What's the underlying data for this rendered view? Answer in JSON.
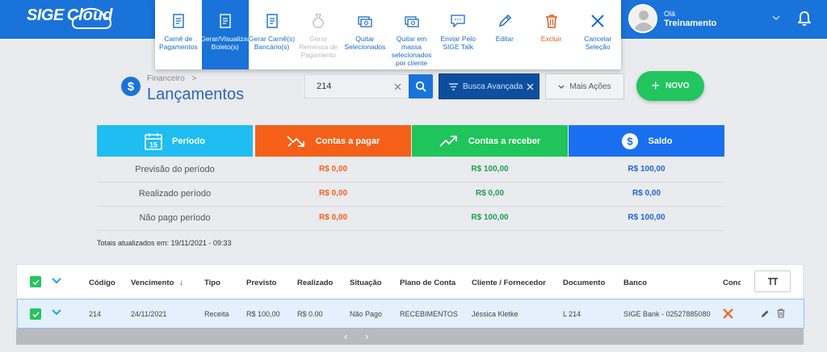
{
  "app": {
    "logo_part1": "SIGE",
    "logo_part2": "Cloud"
  },
  "user": {
    "greeting": "Olá",
    "name": "Treinamento"
  },
  "toolbar": {
    "items": [
      {
        "label": "Carnê de Pagamentos",
        "icon": "document-icon",
        "state": "normal"
      },
      {
        "label": "Gerar/Visualizar Boleto(s)",
        "icon": "document-icon",
        "state": "active"
      },
      {
        "label": "Gerar Carnê(s) Bancário(s)",
        "icon": "document-icon",
        "state": "normal"
      },
      {
        "label": "Gerar Remessa de Pagamento",
        "icon": "money-bag-icon",
        "state": "disabled"
      },
      {
        "label": "Quitar Selecionados",
        "icon": "cash-icon",
        "state": "normal"
      },
      {
        "label": "Quitar em massa selecionados por cliente",
        "icon": "cash-icon",
        "state": "normal"
      },
      {
        "label": "Enviar Pelo SIGE Talk",
        "icon": "chat-icon",
        "state": "normal"
      },
      {
        "label": "Editar",
        "icon": "pencil-icon",
        "state": "normal"
      },
      {
        "label": "Excluir",
        "icon": "trash-icon",
        "state": "danger"
      },
      {
        "label": "Cancelar Seleção",
        "icon": "close-icon",
        "state": "normal"
      }
    ]
  },
  "header": {
    "breadcrumb": "Financeiro",
    "breadcrumb_sep": ">",
    "title": "Lançamentos",
    "search_value": "214",
    "advanced_search": "Busca Avançada",
    "more_actions": "Mais Ações",
    "new_button": "NOVO"
  },
  "summary": {
    "cards": [
      {
        "label": "Período",
        "color": "#1fbdf2",
        "icon": "calendar-icon"
      },
      {
        "label": "Contas a pagar",
        "color": "#f4601a",
        "icon": "trend-down-icon"
      },
      {
        "label": "Contas a receber",
        "color": "#1fc45b",
        "icon": "trend-up-icon"
      },
      {
        "label": "Saldo",
        "color": "#1a6ff0",
        "icon": "dollar-icon"
      }
    ],
    "rows": [
      {
        "label": "Previsão do período",
        "pagar": "R$ 0,00",
        "receber": "R$ 100,00",
        "saldo": "R$ 100,00"
      },
      {
        "label": "Realizado período",
        "pagar": "R$ 0,00",
        "receber": "R$ 0,00",
        "saldo": "R$ 0,00"
      },
      {
        "label": "Não pago período",
        "pagar": "R$ 0,00",
        "receber": "R$ 100,00",
        "saldo": "R$ 100,00"
      }
    ],
    "updated": "Totais atualizados em: 19/11/2021 - 09:33"
  },
  "table": {
    "columns": {
      "codigo": "Código",
      "vencimento": "Vencimento",
      "sort_arrow": "↓",
      "tipo": "Tipo",
      "previsto": "Previsto",
      "realizado": "Realizado",
      "situacao": "Situação",
      "plano": "Plano de Conta",
      "cliente": "Cliente / Fornecedor",
      "documento": "Documento",
      "banco": "Banco",
      "conc": "Conc"
    },
    "rows": [
      {
        "codigo": "214",
        "vencimento": "24/11/2021",
        "tipo": "Receita",
        "previsto": "R$ 100,00",
        "realizado": "R$ 0.00",
        "situacao": "Não Pago",
        "plano": "RECEBIMENTOS",
        "cliente": "Jéssica Kletke",
        "documento": "L 214",
        "banco": "SIGE Bank - 02527885080"
      }
    ]
  },
  "scroll": {
    "left": "‹",
    "right": "›"
  }
}
